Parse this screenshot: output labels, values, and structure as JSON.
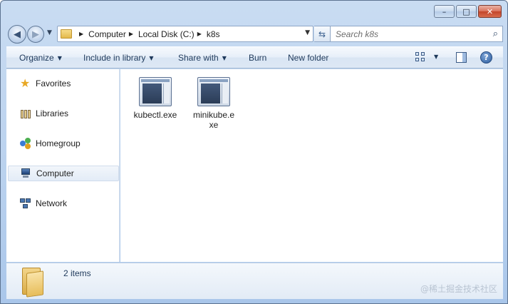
{
  "window": {
    "caption_buttons": {
      "minimize": "–",
      "maximize": "□",
      "close": "✕"
    }
  },
  "address_bar": {
    "crumbs": [
      "Computer",
      "Local Disk (C:)",
      "k8s"
    ]
  },
  "search": {
    "placeholder": "Search k8s"
  },
  "command_bar": {
    "organize": "Organize",
    "include_in_library": "Include in library",
    "share_with": "Share with",
    "burn": "Burn",
    "new_folder": "New folder",
    "help": "?"
  },
  "nav_pane": {
    "items": [
      {
        "label": "Favorites",
        "icon": "star-icon"
      },
      {
        "label": "Libraries",
        "icon": "libraries-icon"
      },
      {
        "label": "Homegroup",
        "icon": "homegroup-icon"
      },
      {
        "label": "Computer",
        "icon": "computer-icon",
        "selected": true
      },
      {
        "label": "Network",
        "icon": "network-icon"
      }
    ]
  },
  "files": [
    {
      "name": "kubectl.exe",
      "icon": "exe-file-icon"
    },
    {
      "name": "minikube.exe",
      "icon": "exe-file-icon"
    }
  ],
  "details": {
    "item_count": "2 items"
  },
  "watermark": "@稀土掘金技术社区",
  "colors": {
    "frame": "#b9d1ee",
    "selection": "#e3ecf7",
    "command_text": "#1e395b"
  }
}
